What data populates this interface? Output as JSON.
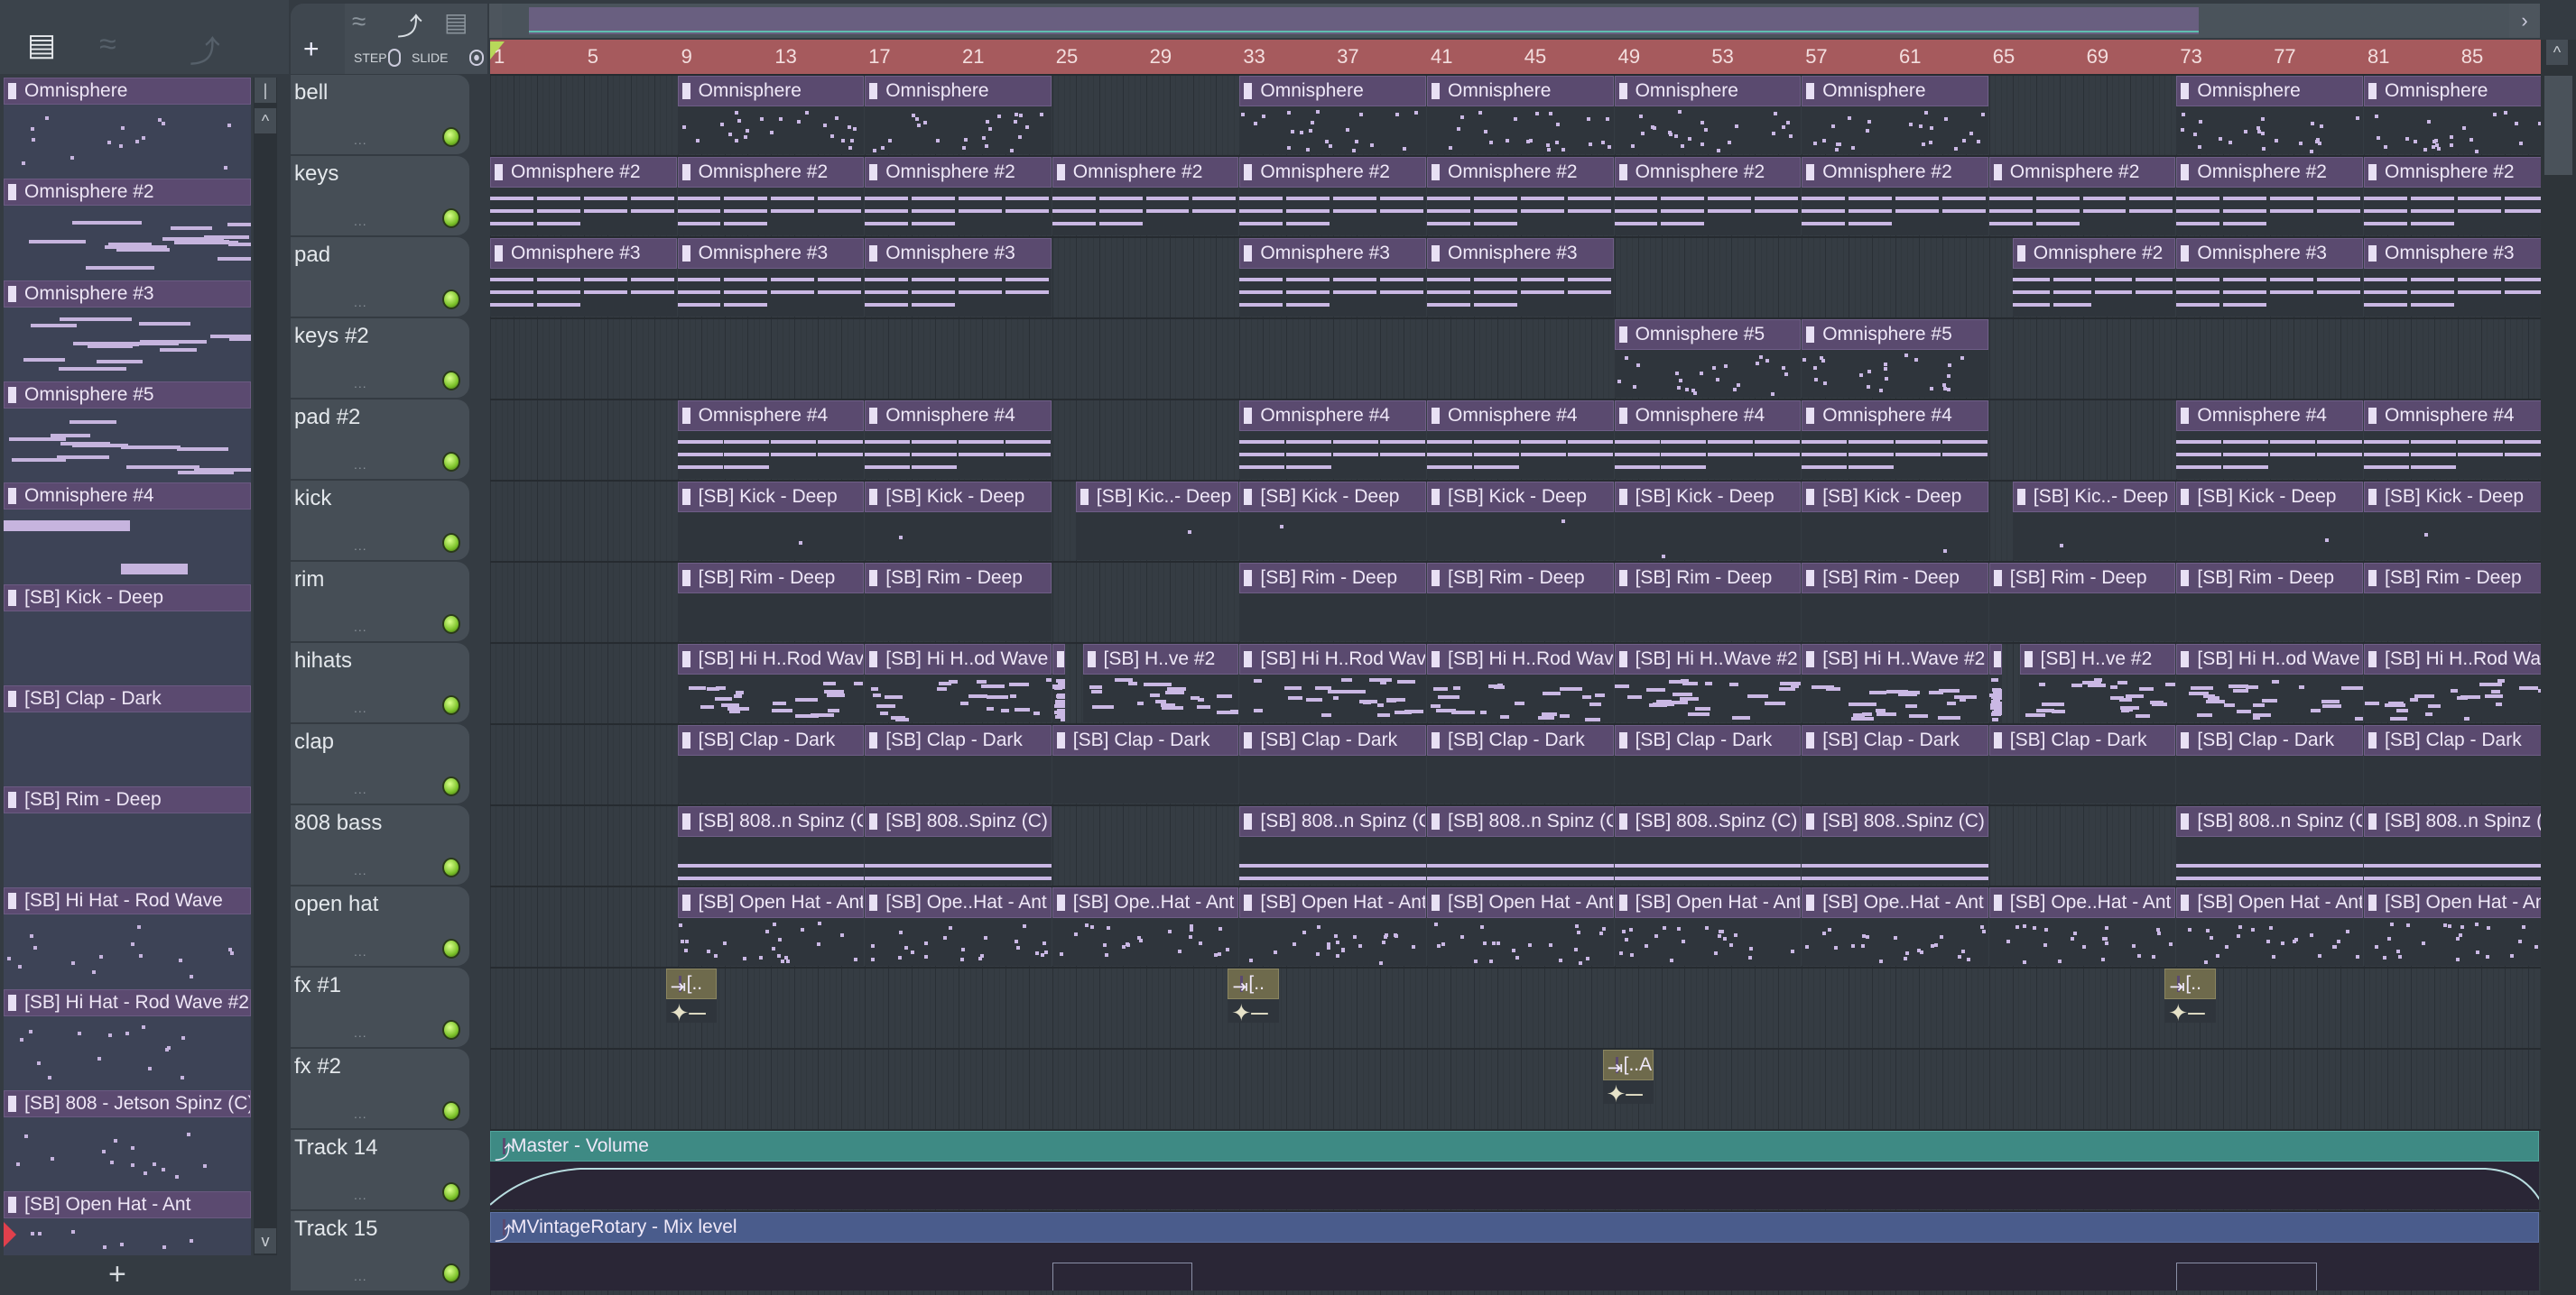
{
  "picker": {
    "toolbar_icons": [
      "piano-roll-icon",
      "audio-wave-icon",
      "automation-icon"
    ],
    "items": [
      "Omnisphere",
      "Omnisphere #2",
      "Omnisphere #3",
      "Omnisphere #5",
      "Omnisphere #4",
      "[SB] Kick - Deep",
      "[SB] Clap - Dark",
      "[SB] Rim - Deep",
      "[SB] Hi Hat - Rod Wave",
      "[SB] Hi Hat - Rod Wave #2",
      "[SB] 808 - Jetson Spinz (C)",
      "[SB] Open Hat - Ant"
    ],
    "add_label": "+"
  },
  "toolbar": {
    "add_label": "+",
    "step_label": "STEP",
    "slide_label": "SLIDE",
    "slide_on": true,
    "step_on": false
  },
  "ruler": {
    "labels": [
      "1",
      "5",
      "9",
      "13",
      "17",
      "21",
      "25",
      "29",
      "33",
      "37",
      "41",
      "45",
      "49",
      "53",
      "57",
      "61",
      "65",
      "69",
      "73",
      "77",
      "81",
      "85"
    ]
  },
  "colors": {
    "clip": "#5a4a6f",
    "ruler": "#a65a5d",
    "automation_master": "#3e8a84",
    "automation_rotary": "#4a5c8c",
    "audio_clip": "#6e6a4c",
    "notes": "#cab8e4"
  },
  "tracks": [
    {
      "name": "bell",
      "clips": [
        {
          "bar": 9,
          "len": 8,
          "label": "Omnisphere"
        },
        {
          "bar": 17,
          "len": 8,
          "label": "Omnisphere"
        },
        {
          "bar": 33,
          "len": 8,
          "label": "Omnisphere"
        },
        {
          "bar": 41,
          "len": 8,
          "label": "Omnisphere"
        },
        {
          "bar": 49,
          "len": 8,
          "label": "Omnisphere"
        },
        {
          "bar": 57,
          "len": 8,
          "label": "Omnisphere"
        },
        {
          "bar": 73,
          "len": 8,
          "label": "Omnisphere"
        },
        {
          "bar": 81,
          "len": 8,
          "label": "Omnisphere"
        }
      ]
    },
    {
      "name": "keys",
      "clips": [
        {
          "bar": 1,
          "len": 8,
          "label": "Omnisphere #2"
        },
        {
          "bar": 9,
          "len": 8,
          "label": "Omnisphere #2"
        },
        {
          "bar": 17,
          "len": 8,
          "label": "Omnisphere #2"
        },
        {
          "bar": 25,
          "len": 8,
          "label": "Omnisphere #2"
        },
        {
          "bar": 33,
          "len": 8,
          "label": "Omnisphere #2"
        },
        {
          "bar": 41,
          "len": 8,
          "label": "Omnisphere #2"
        },
        {
          "bar": 49,
          "len": 8,
          "label": "Omnisphere #2"
        },
        {
          "bar": 57,
          "len": 8,
          "label": "Omnisphere #2"
        },
        {
          "bar": 65,
          "len": 8,
          "label": "Omnisphere #2"
        },
        {
          "bar": 73,
          "len": 8,
          "label": "Omnisphere #2"
        },
        {
          "bar": 81,
          "len": 8,
          "label": "Omnisphere #2"
        }
      ]
    },
    {
      "name": "pad",
      "clips": [
        {
          "bar": 1,
          "len": 8,
          "label": "Omnisphere #3"
        },
        {
          "bar": 9,
          "len": 8,
          "label": "Omnisphere #3"
        },
        {
          "bar": 17,
          "len": 8,
          "label": "Omnisphere #3"
        },
        {
          "bar": 33,
          "len": 8,
          "label": "Omnisphere #3"
        },
        {
          "bar": 41,
          "len": 8,
          "label": "Omnisphere #3"
        },
        {
          "bar": 66,
          "len": 7,
          "label": "Omnisphere #2"
        },
        {
          "bar": 73,
          "len": 8,
          "label": "Omnisphere #3"
        },
        {
          "bar": 81,
          "len": 8,
          "label": "Omnisphere #3"
        }
      ]
    },
    {
      "name": "keys #2",
      "clips": [
        {
          "bar": 49,
          "len": 8,
          "label": "Omnisphere #5"
        },
        {
          "bar": 57,
          "len": 8,
          "label": "Omnisphere #5"
        }
      ]
    },
    {
      "name": "pad #2",
      "clips": [
        {
          "bar": 9,
          "len": 8,
          "label": "Omnisphere #4"
        },
        {
          "bar": 17,
          "len": 8,
          "label": "Omnisphere #4"
        },
        {
          "bar": 33,
          "len": 8,
          "label": "Omnisphere #4"
        },
        {
          "bar": 41,
          "len": 8,
          "label": "Omnisphere #4"
        },
        {
          "bar": 49,
          "len": 8,
          "label": "Omnisphere #4"
        },
        {
          "bar": 57,
          "len": 8,
          "label": "Omnisphere #4"
        },
        {
          "bar": 73,
          "len": 8,
          "label": "Omnisphere #4"
        },
        {
          "bar": 81,
          "len": 8,
          "label": "Omnisphere #4"
        }
      ]
    },
    {
      "name": "kick",
      "clips": [
        {
          "bar": 9,
          "len": 8,
          "label": "[SB] Kick - Deep"
        },
        {
          "bar": 17,
          "len": 8,
          "label": "[SB] Kick - Deep"
        },
        {
          "bar": 26,
          "len": 7,
          "label": "[SB] Kic..- Deep"
        },
        {
          "bar": 33,
          "len": 8,
          "label": "[SB] Kick - Deep"
        },
        {
          "bar": 41,
          "len": 8,
          "label": "[SB] Kick - Deep"
        },
        {
          "bar": 49,
          "len": 8,
          "label": "[SB] Kick - Deep"
        },
        {
          "bar": 57,
          "len": 8,
          "label": "[SB] Kick - Deep"
        },
        {
          "bar": 66,
          "len": 7,
          "label": "[SB] Kic..- Deep"
        },
        {
          "bar": 73,
          "len": 8,
          "label": "[SB] Kick - Deep"
        },
        {
          "bar": 81,
          "len": 8,
          "label": "[SB] Kick - Deep"
        }
      ]
    },
    {
      "name": "rim",
      "clips": [
        {
          "bar": 9,
          "len": 8,
          "label": "[SB] Rim - Deep"
        },
        {
          "bar": 17,
          "len": 8,
          "label": "[SB] Rim - Deep"
        },
        {
          "bar": 33,
          "len": 8,
          "label": "[SB] Rim - Deep"
        },
        {
          "bar": 41,
          "len": 8,
          "label": "[SB] Rim - Deep"
        },
        {
          "bar": 49,
          "len": 8,
          "label": "[SB] Rim - Deep"
        },
        {
          "bar": 57,
          "len": 8,
          "label": "[SB] Rim - Deep"
        },
        {
          "bar": 65,
          "len": 8,
          "label": "[SB] Rim - Deep"
        },
        {
          "bar": 73,
          "len": 8,
          "label": "[SB] Rim - Deep"
        },
        {
          "bar": 81,
          "len": 8,
          "label": "[SB] Rim - Deep"
        }
      ]
    },
    {
      "name": "hihats",
      "clips": [
        {
          "bar": 9,
          "len": 8,
          "label": "[SB] Hi H..Rod Wave"
        },
        {
          "bar": 17,
          "len": 8,
          "label": "[SB] Hi H..od Wave"
        },
        {
          "bar": 25,
          "len": 0.6,
          "label": ""
        },
        {
          "bar": 26.3,
          "len": 6.7,
          "label": "[SB] H..ve #2"
        },
        {
          "bar": 33,
          "len": 8,
          "label": "[SB] Hi H..Rod Wave"
        },
        {
          "bar": 41,
          "len": 8,
          "label": "[SB] Hi H..Rod Wave"
        },
        {
          "bar": 49,
          "len": 8,
          "label": "[SB] Hi H..Wave #2"
        },
        {
          "bar": 57,
          "len": 8,
          "label": "[SB] Hi H..Wave #2"
        },
        {
          "bar": 65,
          "len": 0.6,
          "label": ""
        },
        {
          "bar": 66.3,
          "len": 6.7,
          "label": "[SB] H..ve #2"
        },
        {
          "bar": 73,
          "len": 8,
          "label": "[SB] Hi H..od Wave"
        },
        {
          "bar": 81,
          "len": 8,
          "label": "[SB] Hi H..Rod Wave"
        }
      ]
    },
    {
      "name": "clap",
      "clips": [
        {
          "bar": 9,
          "len": 8,
          "label": "[SB] Clap - Dark"
        },
        {
          "bar": 17,
          "len": 8,
          "label": "[SB] Clap - Dark"
        },
        {
          "bar": 25,
          "len": 8,
          "label": "[SB] Clap - Dark"
        },
        {
          "bar": 33,
          "len": 8,
          "label": "[SB] Clap - Dark"
        },
        {
          "bar": 41,
          "len": 8,
          "label": "[SB] Clap - Dark"
        },
        {
          "bar": 49,
          "len": 8,
          "label": "[SB] Clap - Dark"
        },
        {
          "bar": 57,
          "len": 8,
          "label": "[SB] Clap - Dark"
        },
        {
          "bar": 65,
          "len": 8,
          "label": "[SB] Clap - Dark"
        },
        {
          "bar": 73,
          "len": 8,
          "label": "[SB] Clap - Dark"
        },
        {
          "bar": 81,
          "len": 8,
          "label": "[SB] Clap - Dark"
        }
      ]
    },
    {
      "name": "808 bass",
      "clips": [
        {
          "bar": 9,
          "len": 8,
          "label": "[SB] 808..n Spinz (C)"
        },
        {
          "bar": 17,
          "len": 8,
          "label": "[SB] 808..Spinz (C)"
        },
        {
          "bar": 33,
          "len": 8,
          "label": "[SB] 808..n Spinz (C)"
        },
        {
          "bar": 41,
          "len": 8,
          "label": "[SB] 808..n Spinz (C)"
        },
        {
          "bar": 49,
          "len": 8,
          "label": "[SB] 808..Spinz (C)"
        },
        {
          "bar": 57,
          "len": 8,
          "label": "[SB] 808..Spinz (C)"
        },
        {
          "bar": 73,
          "len": 8,
          "label": "[SB] 808..n Spinz (C)"
        },
        {
          "bar": 81,
          "len": 8,
          "label": "[SB] 808..n Spinz (C)"
        }
      ]
    },
    {
      "name": "open hat",
      "clips": [
        {
          "bar": 9,
          "len": 8,
          "label": "[SB] Open Hat - Ant"
        },
        {
          "bar": 17,
          "len": 8,
          "label": "[SB] Ope..Hat - Ant"
        },
        {
          "bar": 25,
          "len": 8,
          "label": "[SB] Ope..Hat - Ant"
        },
        {
          "bar": 33,
          "len": 8,
          "label": "[SB] Open Hat - Ant"
        },
        {
          "bar": 41,
          "len": 8,
          "label": "[SB] Open Hat - Ant"
        },
        {
          "bar": 49,
          "len": 8,
          "label": "[SB] Open Hat - Ant"
        },
        {
          "bar": 57,
          "len": 8,
          "label": "[SB] Ope..Hat - Ant"
        },
        {
          "bar": 65,
          "len": 8,
          "label": "[SB] Ope..Hat - Ant"
        },
        {
          "bar": 73,
          "len": 8,
          "label": "[SB] Open Hat - Ant"
        },
        {
          "bar": 81,
          "len": 8,
          "label": "[SB] Open Hat - Ant"
        }
      ]
    },
    {
      "name": "fx #1",
      "kind": "audio",
      "clips": [
        {
          "bar": 8.5,
          "len": 2.2,
          "label": "[.."
        },
        {
          "bar": 32.5,
          "len": 2.2,
          "label": "[.."
        },
        {
          "bar": 72.5,
          "len": 2.2,
          "label": "[.."
        }
      ]
    },
    {
      "name": "fx #2",
      "kind": "audio",
      "clips": [
        {
          "bar": 48.5,
          "len": 2.2,
          "label": "[..A"
        }
      ]
    },
    {
      "name": "Track 14",
      "kind": "auto",
      "clips": [
        {
          "bar": 1,
          "len": 87.5,
          "label": "Master - Volume"
        }
      ]
    },
    {
      "name": "Track 15",
      "kind": "auto2",
      "clips": [
        {
          "bar": 1,
          "len": 87.5,
          "label": "MVintageRotary - Mix level"
        }
      ]
    }
  ]
}
